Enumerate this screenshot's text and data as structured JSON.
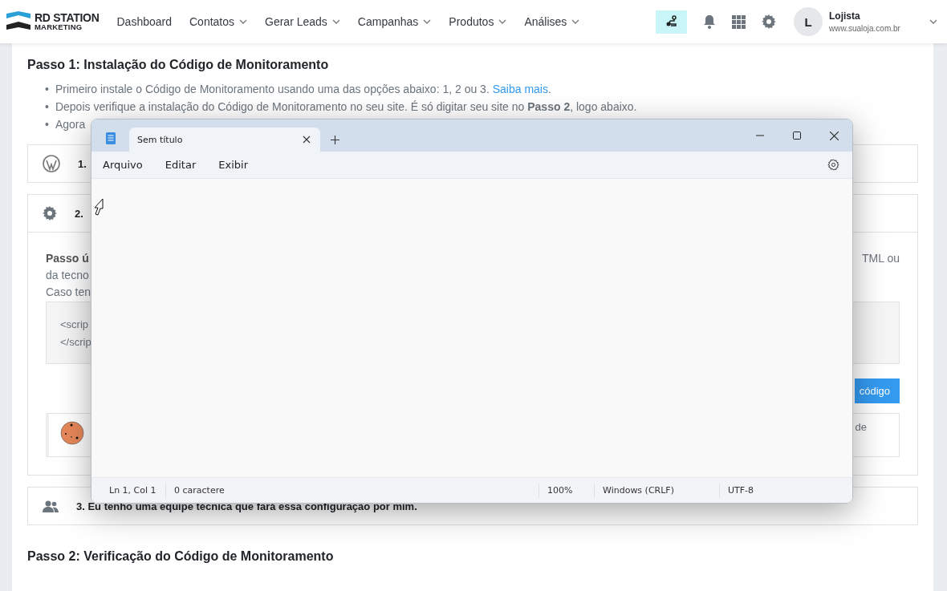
{
  "header": {
    "logo": {
      "line1": "RD STATION",
      "line2": "MARKETING"
    },
    "nav": [
      {
        "label": "Dashboard",
        "dropdown": false
      },
      {
        "label": "Contatos",
        "dropdown": true
      },
      {
        "label": "Gerar Leads",
        "dropdown": true
      },
      {
        "label": "Campanhas",
        "dropdown": true
      },
      {
        "label": "Produtos",
        "dropdown": true
      },
      {
        "label": "Análises",
        "dropdown": true
      }
    ],
    "user": {
      "initial": "L",
      "name": "Lojista",
      "site": "www.sualoja.com.br"
    }
  },
  "step1": {
    "title": "Passo 1: Instalação do Código de Monitoramento",
    "bullets": [
      {
        "marker": "•",
        "text": "Primeiro instale o Código de Monitoramento usando uma das opções abaixo: 1, 2 ou 3. ",
        "link": "Saiba mais",
        "after": "."
      },
      {
        "marker": "•",
        "text": "Depois verifique a instalação do Código de Monitoramento no seu site. É só digitar seu site no **Passo 2**, logo abaixo."
      },
      {
        "marker": "•",
        "text": "Agora"
      }
    ],
    "options": [
      {
        "kind": "wordpress",
        "label": "1.",
        "expanded": false
      },
      {
        "kind": "settings",
        "label": "2.",
        "expanded": true,
        "body": {
          "lines": [
            {
              "left": "Passo ú",
              "bold": true,
              "right": "TML ou"
            },
            {
              "left": "da tecno",
              "bold": false
            },
            {
              "left": "Caso ten",
              "bold": false
            }
          ],
          "code": [
            "<scrip",
            "</scrip"
          ],
          "button": "código",
          "note": "de"
        }
      },
      {
        "kind": "team",
        "label": "3. Eu tenho uma equipe técnica que fará essa configuração por mim.",
        "expanded": false
      }
    ]
  },
  "step2": {
    "title": "Passo 2: Verificação do Código de Monitoramento"
  },
  "notepad": {
    "tab": "Sem título",
    "menu": [
      "Arquivo",
      "Editar",
      "Exibir"
    ],
    "status": [
      "Ln 1, Col 1",
      "0 caractere",
      "100%",
      "Windows (CRLF)",
      "UTF-8"
    ]
  }
}
